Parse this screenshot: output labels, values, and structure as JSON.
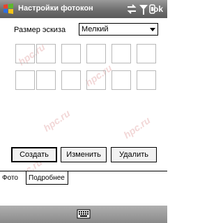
{
  "titlebar": {
    "title": "Настройки фотокон",
    "ok_label": "ok",
    "icons": [
      "windows-flag-icon",
      "sync-icon",
      "signal-icon",
      "volume-icon"
    ]
  },
  "settings": {
    "size_label": "Размер эскиза",
    "size_value": "Мелкий"
  },
  "buttons": {
    "create": "Создать",
    "edit": "Изменить",
    "delete": "Удалить"
  },
  "tabs": {
    "photo": "Фото",
    "details": "Подробнее"
  },
  "watermark": "hpc.ru",
  "colors": {
    "titlebar": "#6e6e6e",
    "watermark": "#e8b8b8"
  }
}
